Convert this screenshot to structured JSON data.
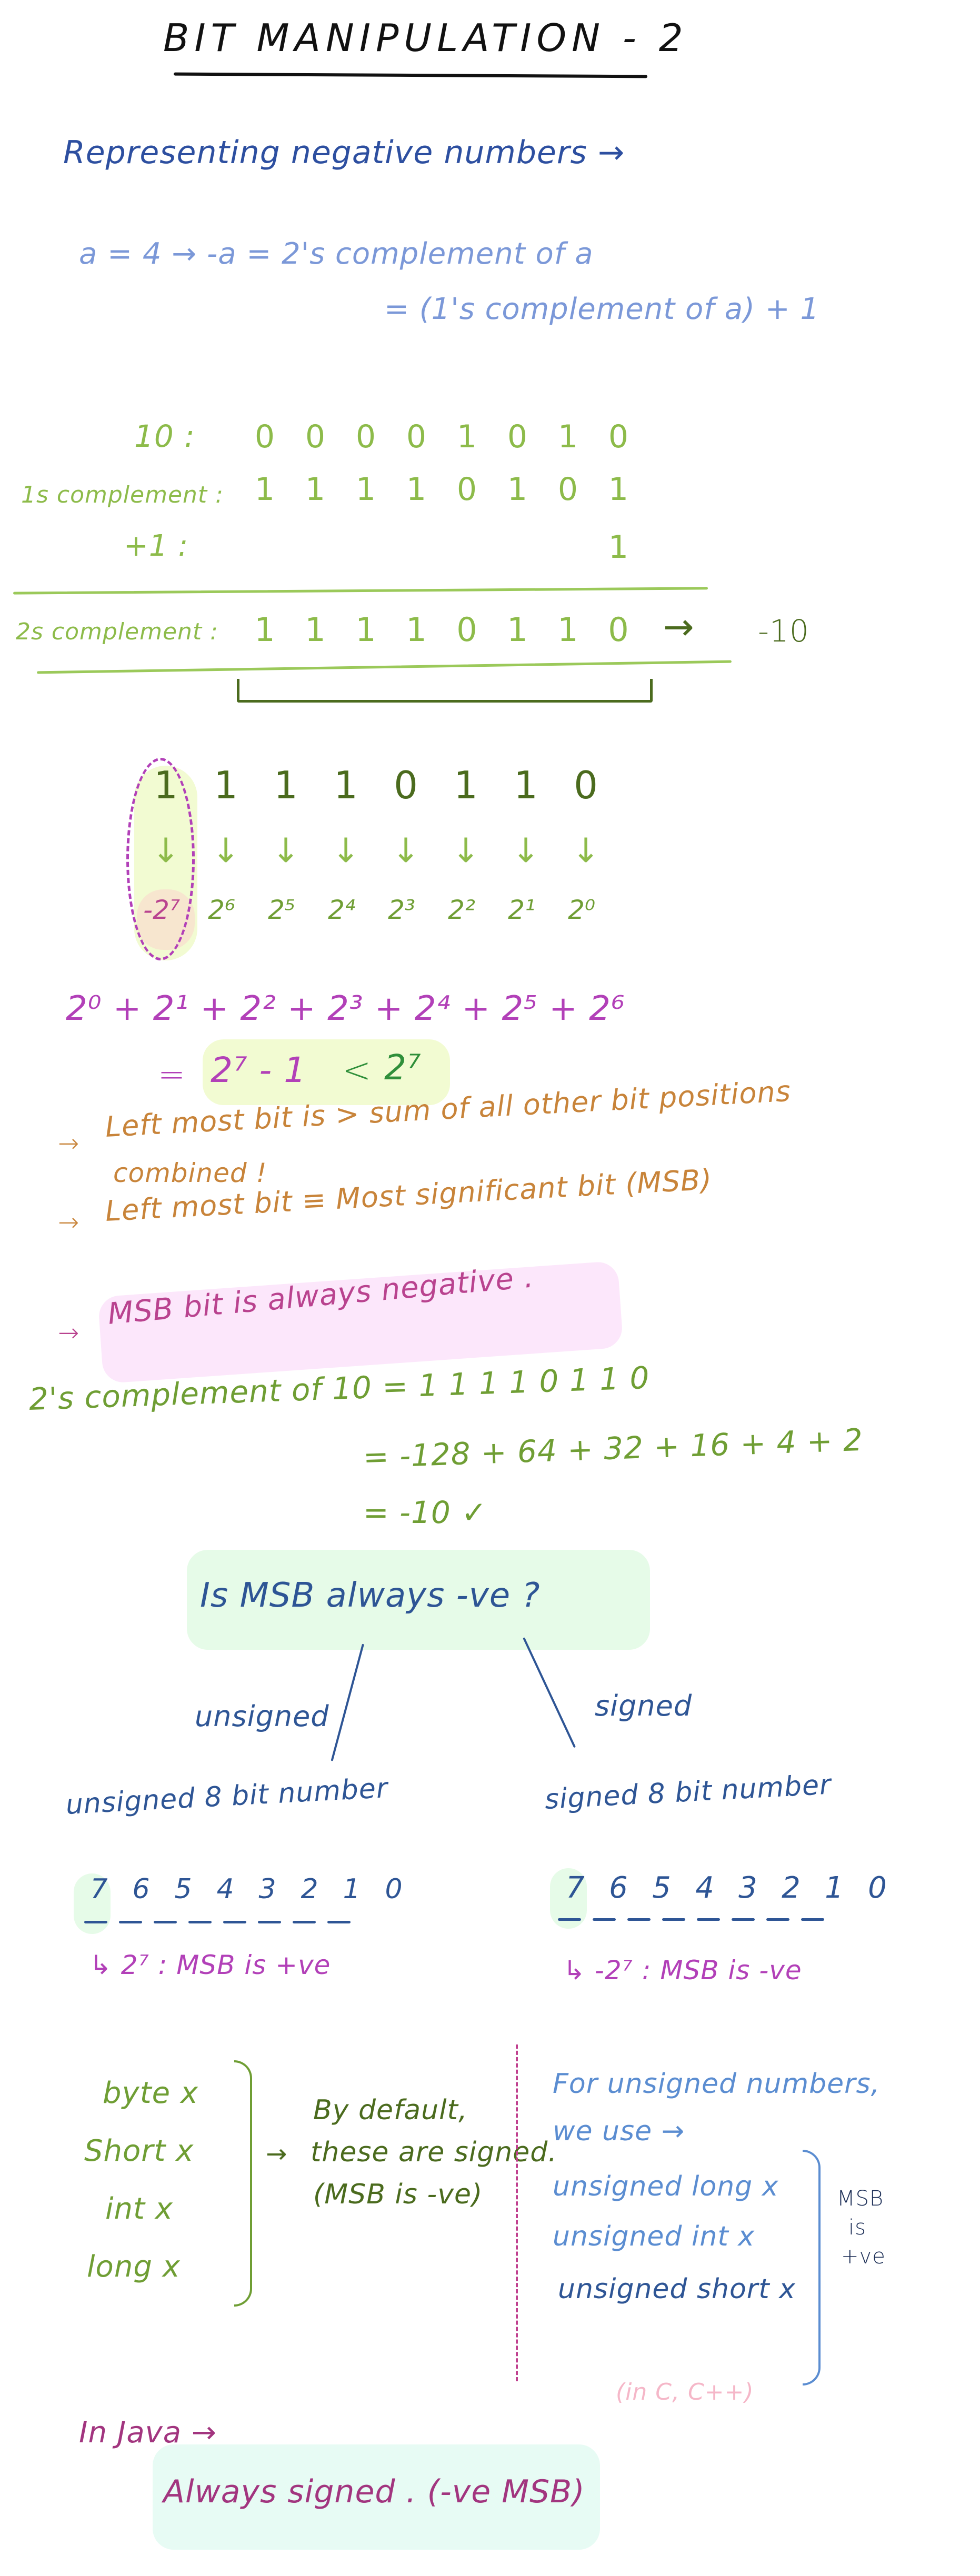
{
  "title": "BIT MANIPULATION - 2",
  "section1": {
    "heading": "Representing negative numbers →",
    "line1": "a = 4  →  -a  =  2's complement of a",
    "line2": "= (1's complement of a) + 1"
  },
  "complement_table": {
    "rows": [
      {
        "label": "10 :",
        "bits": [
          "0",
          "0",
          "0",
          "0",
          "1",
          "0",
          "1",
          "0"
        ]
      },
      {
        "label": "1s complement :",
        "bits": [
          "1",
          "1",
          "1",
          "1",
          "0",
          "1",
          "0",
          "1"
        ]
      },
      {
        "label": "+1 :",
        "bits": [
          "",
          "",
          "",
          "",
          "",
          "",
          "",
          "1"
        ]
      }
    ],
    "result": {
      "label": "2s complement :",
      "bits": [
        "1",
        "1",
        "1",
        "1",
        "0",
        "1",
        "1",
        "0"
      ],
      "arrow": "→",
      "value": "-10"
    }
  },
  "bit_weights": {
    "bits": [
      "1",
      "1",
      "1",
      "1",
      "0",
      "1",
      "1",
      "0"
    ],
    "arrow": "↓",
    "weights": [
      "-2⁷",
      "2⁶",
      "2⁵",
      "2⁴",
      "2³",
      "2²",
      "2¹",
      "2⁰"
    ]
  },
  "sum_expr": {
    "line1": "2⁰ + 2¹ + 2² + 2³ + 2⁴ + 2⁵ + 2⁶",
    "eq": "=",
    "highlight_left": "2⁷ - 1",
    "highlight_op": "<",
    "highlight_right": "2⁷"
  },
  "notes": [
    {
      "arrow": "→",
      "text": "Left most bit is > sum of all other bit positions",
      "cont": "combined !"
    },
    {
      "arrow": "→",
      "text": "Left most bit ≡ Most significant bit (MSB)"
    },
    {
      "arrow": "→",
      "text": "MSB bit is always negative ."
    }
  ],
  "verify": {
    "line1": "2's complement of 10 = 1 1 1 1 0 1 1 0",
    "line2": "= -128 + 64 + 32 + 16 + 4 + 2",
    "line3": "= -10 ✓"
  },
  "question": {
    "text": "Is MSB always -ve ?",
    "left": "unsigned",
    "right": "signed"
  },
  "unsigned8": {
    "heading": "unsigned 8 bit number",
    "positions": [
      "7",
      "6",
      "5",
      "4",
      "3",
      "2",
      "1",
      "0"
    ],
    "note": "↳ 2⁷ : MSB is +ve"
  },
  "signed8": {
    "heading": "signed 8 bit number",
    "positions": [
      "7",
      "6",
      "5",
      "4",
      "3",
      "2",
      "1",
      "0"
    ],
    "note": "↳ -2⁷ : MSB is -ve"
  },
  "java_types": {
    "types": [
      "byte  x",
      "Short  x",
      "int  x",
      "long  x"
    ],
    "arrow": "→",
    "desc": [
      "By default,",
      "these are signed.",
      "(MSB is -ve)"
    ]
  },
  "unsigned_c": {
    "intro1": "For unsigned numbers,",
    "intro2": "we use →",
    "types": [
      "unsigned long x",
      "unsigned int x",
      "unsigned short x"
    ],
    "side_note": [
      "MSB",
      "is",
      "+ve"
    ],
    "lang_note": "(in C, C++)"
  },
  "java_note": {
    "heading": "In Java →",
    "highlight": "Always signed . (-ve MSB)"
  }
}
